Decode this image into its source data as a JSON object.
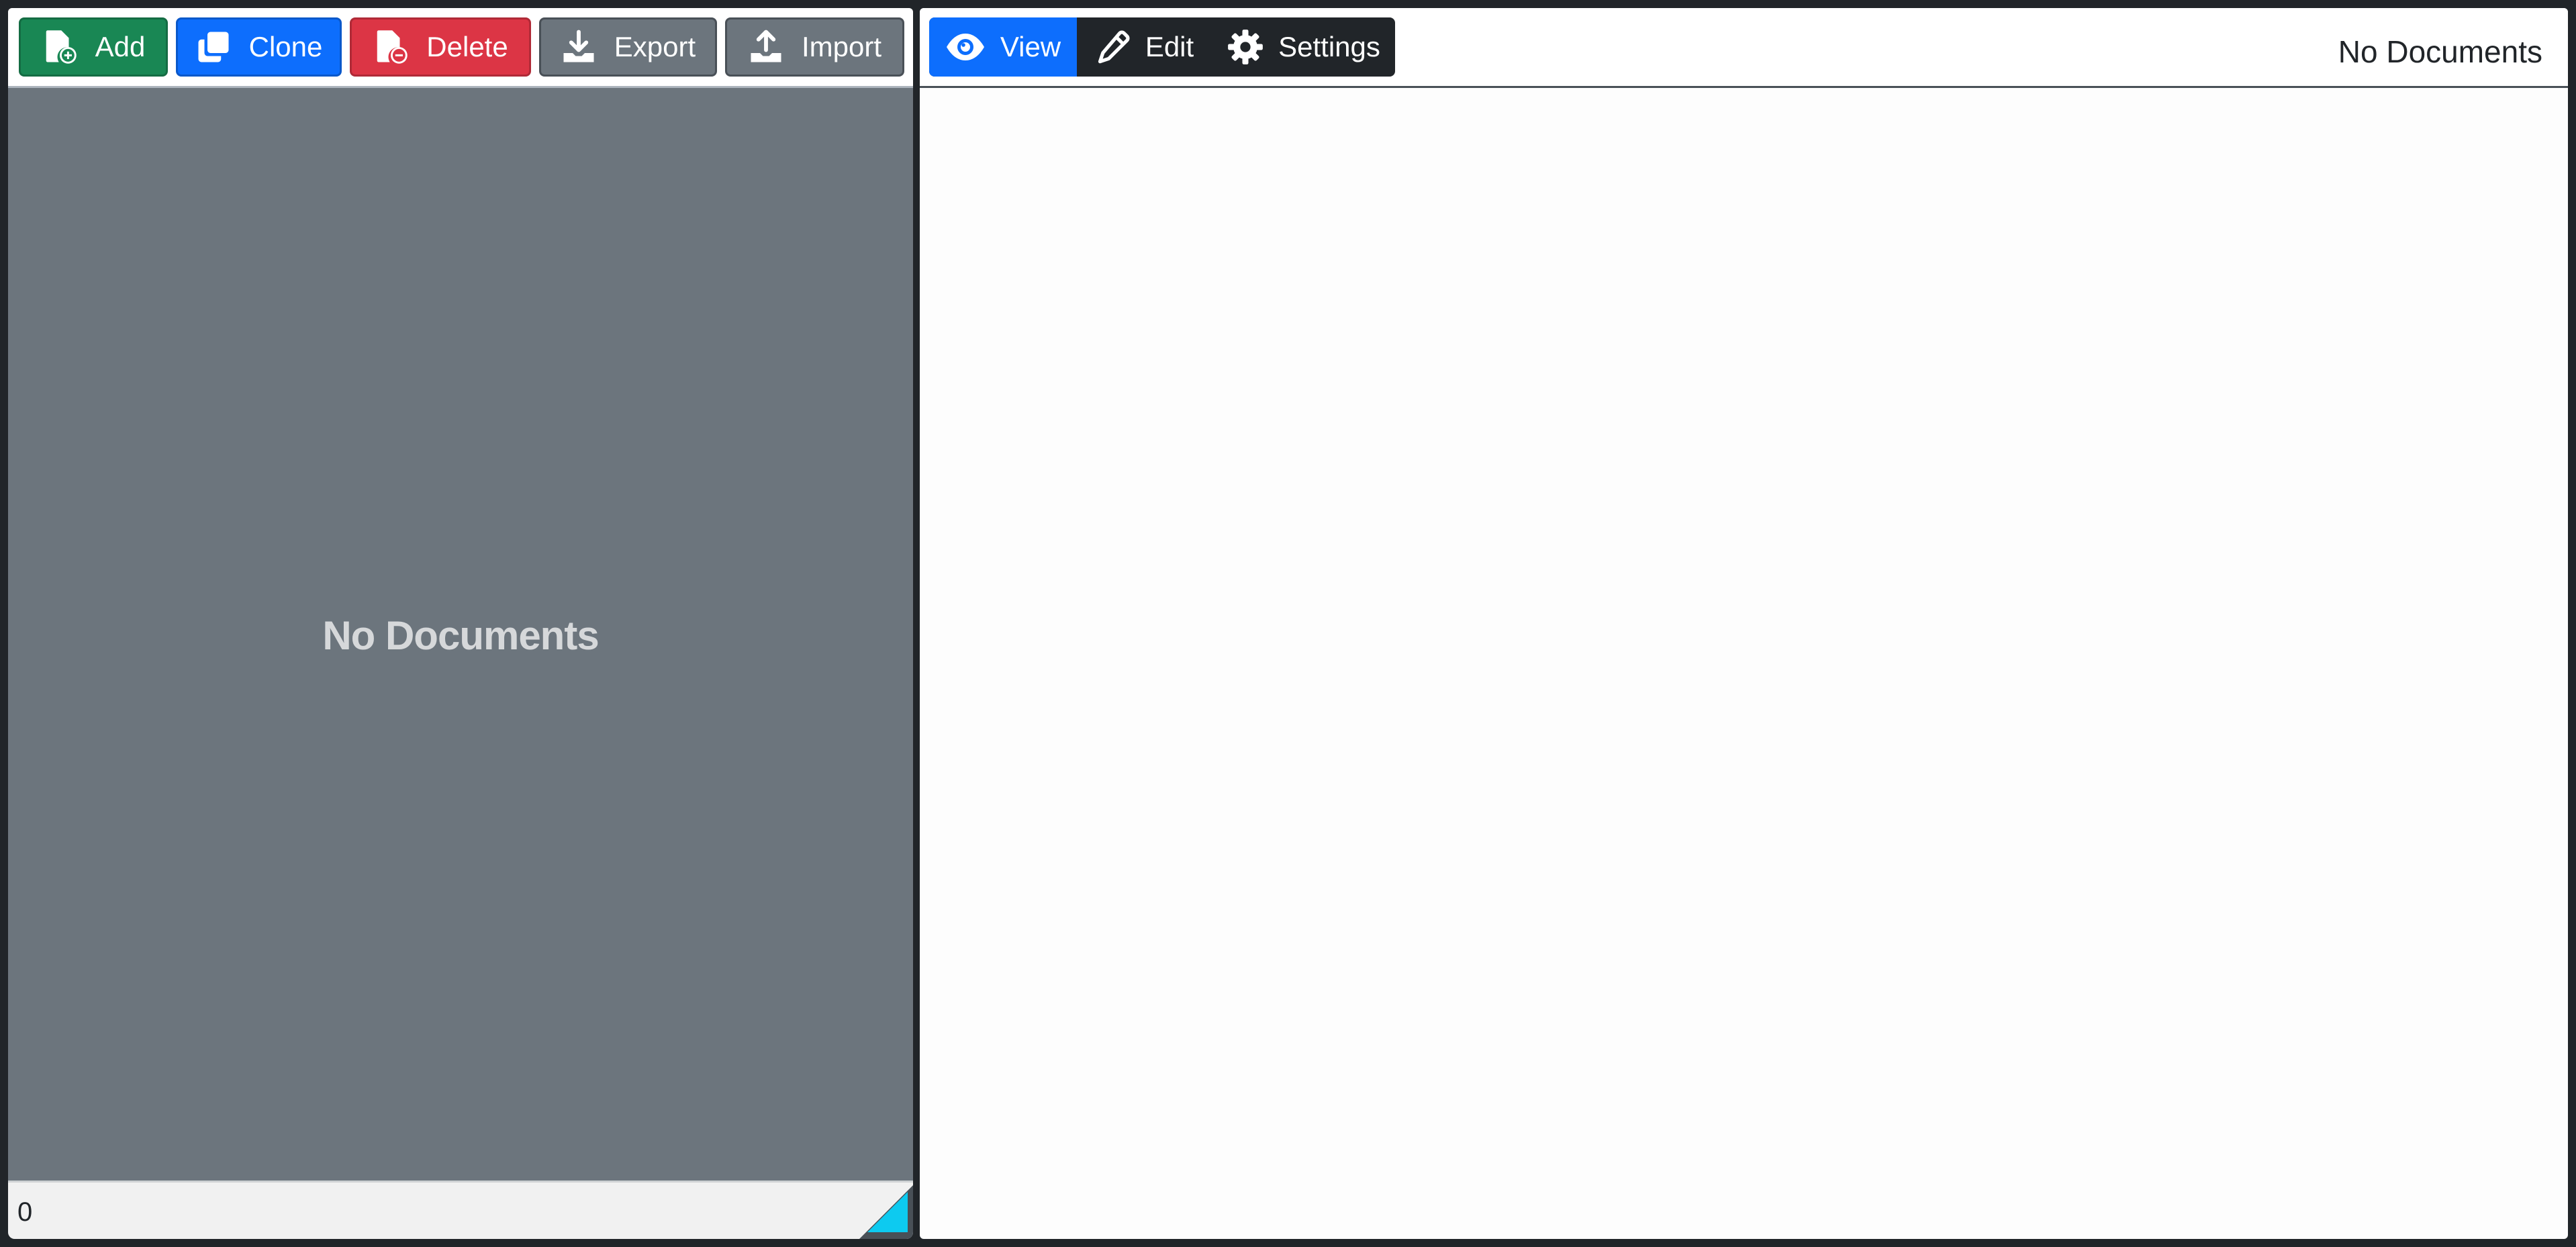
{
  "left_toolbar": {
    "add_label": "Add",
    "clone_label": "Clone",
    "delete_label": "Delete",
    "export_label": "Export",
    "import_label": "Import"
  },
  "left_panel": {
    "empty_message": "No Documents",
    "footer_count": "0"
  },
  "right_toolbar": {
    "tabs": [
      {
        "label": "View",
        "icon": "eye-icon",
        "active": true
      },
      {
        "label": "Edit",
        "icon": "pencil-icon",
        "active": false
      },
      {
        "label": "Settings",
        "icon": "gear-icon",
        "active": false
      }
    ],
    "status": "No Documents"
  },
  "colors": {
    "add": "#198754",
    "clone": "#0d6efd",
    "delete": "#dc3545",
    "secondary": "#6c757d",
    "tab_bar": "#212529",
    "active_tab": "#0d6efd",
    "resize_accent": "#0dcaf0"
  }
}
